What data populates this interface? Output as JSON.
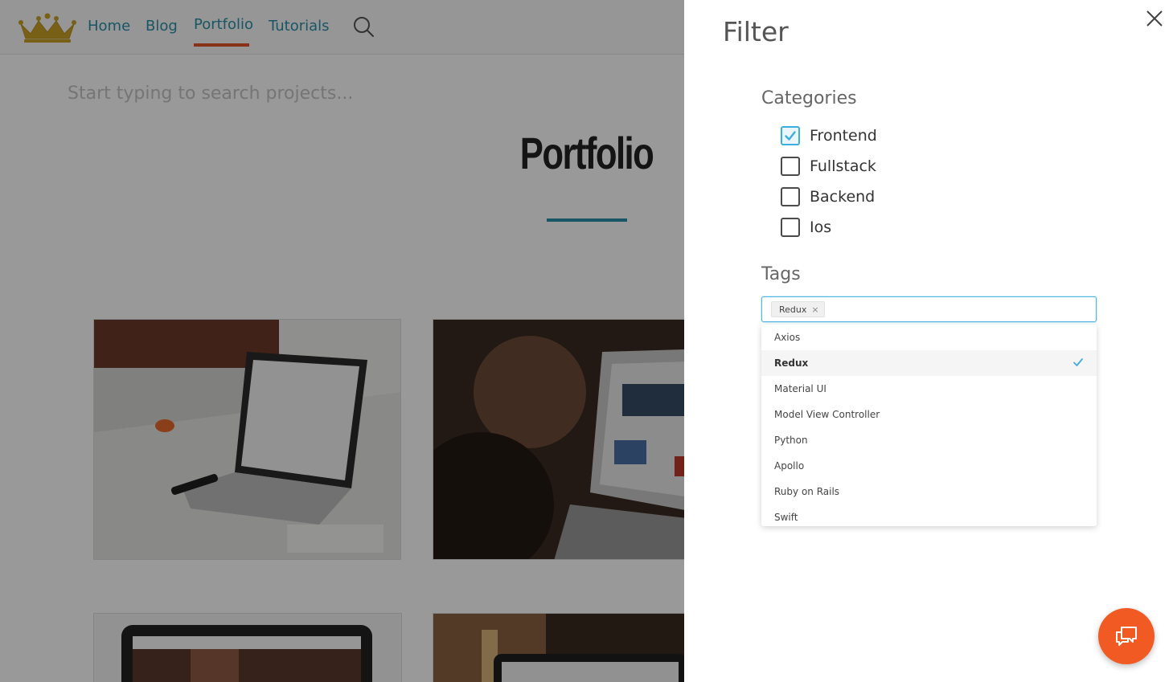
{
  "nav": {
    "links": [
      "Home",
      "Blog",
      "Portfolio",
      "Tutorials"
    ],
    "active": "Portfolio"
  },
  "search": {
    "placeholder": "Start typing to search projects..."
  },
  "page": {
    "title": "Portfolio"
  },
  "filter": {
    "title": "Filter",
    "categories_heading": "Categories",
    "categories": [
      {
        "label": "Frontend",
        "checked": true
      },
      {
        "label": "Fullstack",
        "checked": false
      },
      {
        "label": "Backend",
        "checked": false
      },
      {
        "label": "Ios",
        "checked": false
      }
    ],
    "tags_heading": "Tags",
    "selected_tags": [
      "Redux"
    ],
    "options": [
      {
        "label": "Axios",
        "selected": false
      },
      {
        "label": "Redux",
        "selected": true
      },
      {
        "label": "Material UI",
        "selected": false
      },
      {
        "label": "Model View Controller",
        "selected": false
      },
      {
        "label": "Python",
        "selected": false
      },
      {
        "label": "Apollo",
        "selected": false
      },
      {
        "label": "Ruby on Rails",
        "selected": false
      },
      {
        "label": "Swift",
        "selected": false
      }
    ]
  },
  "colors": {
    "accent": "#2a8fa8",
    "nav_underline": "#e2562b",
    "checkbox_checked": "#3eaee0",
    "fab": "#f15a22"
  },
  "icons": {
    "logo": "crown-logo",
    "search": "search-icon",
    "close": "close-icon",
    "chat": "chat-icon",
    "check": "check-icon"
  }
}
